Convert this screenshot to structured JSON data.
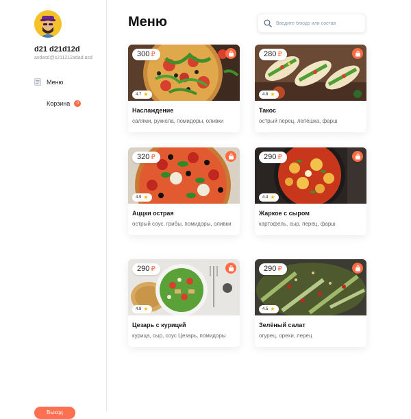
{
  "user": {
    "name": "d21 d21d12d",
    "email": "asdasd@s211212adad.asd"
  },
  "nav": {
    "menu_label": "Меню",
    "cart_label": "Корзина",
    "cart_count": "0",
    "logout_label": "Выход"
  },
  "page": {
    "title": "Меню"
  },
  "search": {
    "placeholder": "Введите блюдо или состав",
    "value": ""
  },
  "currency": "₽",
  "colors": {
    "accent": "#ff6b43",
    "star": "#f5b800"
  },
  "dishes": [
    {
      "price": "300",
      "rating": "4.7",
      "name": "Наслаждение",
      "ingredients": "салями, руккола, помидоры, оливки"
    },
    {
      "price": "280",
      "rating": "4.8",
      "name": "Такос",
      "ingredients": "острый перец, лепёшка, фарш"
    },
    {
      "price": "320",
      "rating": "4.9",
      "name": "Аццки острая",
      "ingredients": "острый соус, грибы, помидоры, оливки"
    },
    {
      "price": "290",
      "rating": "4.4",
      "name": "Жаркое с сыром",
      "ingredients": "картофель, сыр, перец, фарш"
    },
    {
      "price": "290",
      "rating": "4.8",
      "name": "Цезарь с курицей",
      "ingredients": "курица, сыр, соус Цезарь, помидоры"
    },
    {
      "price": "290",
      "rating": "4.5",
      "name": "Зелёный салат",
      "ingredients": "огурец, орехи, перец"
    }
  ]
}
